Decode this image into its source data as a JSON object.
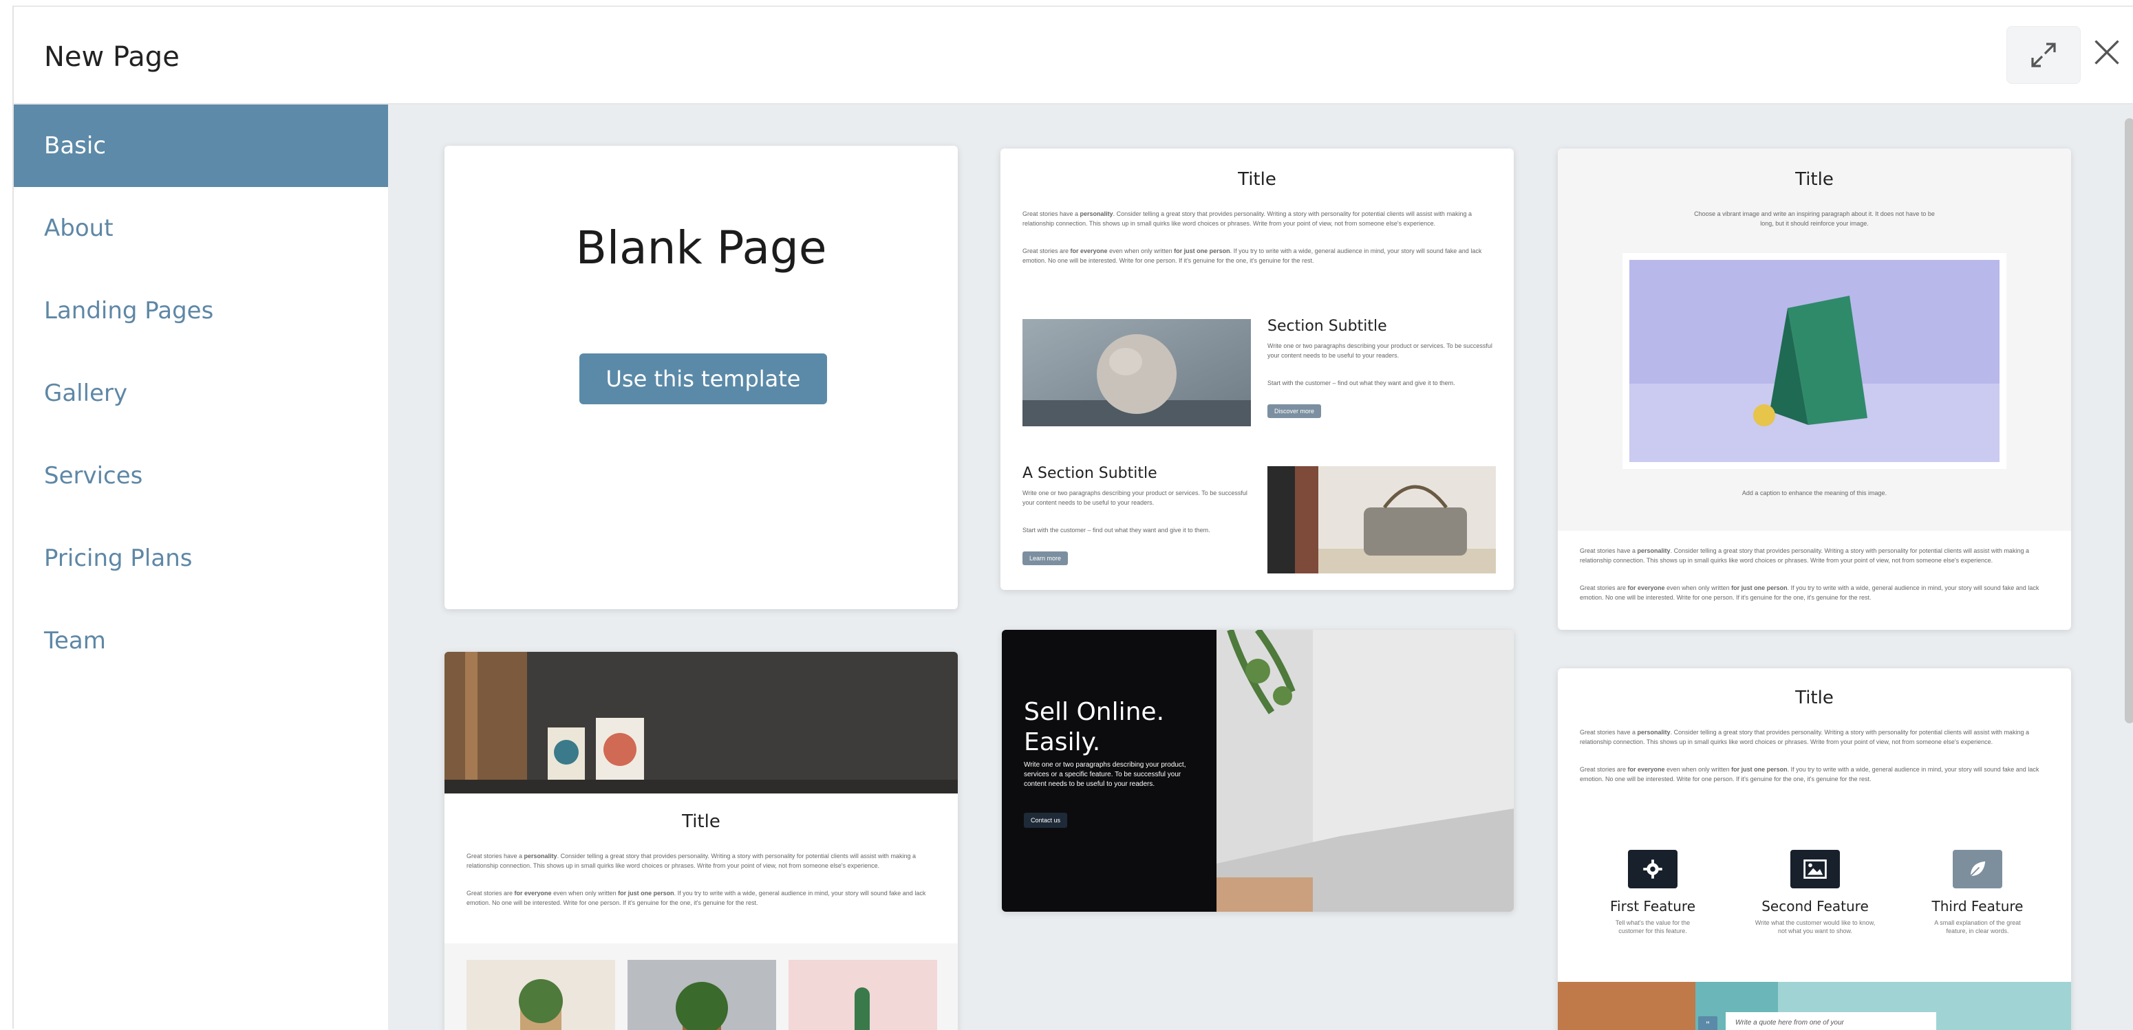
{
  "dialog": {
    "title": "New Page"
  },
  "sidebar": {
    "items": [
      {
        "label": "Basic",
        "active": true
      },
      {
        "label": "About"
      },
      {
        "label": "Landing Pages"
      },
      {
        "label": "Gallery"
      },
      {
        "label": "Services"
      },
      {
        "label": "Pricing Plans"
      },
      {
        "label": "Team"
      }
    ]
  },
  "templates": {
    "blank": {
      "title": "Blank Page",
      "button": "Use this template"
    },
    "t2": {
      "title": "Title",
      "p1_pre": "Great stories have a ",
      "p1_bold": "personality",
      "p1_post": ". Consider telling a great story that provides personality. Writing a story with personality for potential clients will assist with making a relationship connection. This shows up in small quirks like word choices or phrases. Write from your point of view, not from someone else's experience.",
      "p2_pre": "Great stories are ",
      "p2_bold1": "for everyone",
      "p2_mid": " even when only written ",
      "p2_bold2": "for just one person",
      "p2_post": ". If you try to write with a wide, general audience in mind, your story will sound fake and lack emotion. No one will be interested. Write for one person. If it's genuine for the one, it's genuine for the rest.",
      "s1_title": "Section Subtitle",
      "s1_text1": "Write one or two paragraphs describing your product or services. To be successful your content needs to be useful to your readers.",
      "s1_text2": "Start with the customer – find out what they want and give it to them.",
      "s1_btn": "Discover more",
      "s2_title": "A Section Subtitle",
      "s2_text1": "Write one or two paragraphs describing your product or services. To be successful your content needs to be useful to your readers.",
      "s2_text2": "Start with the customer – find out what they want and give it to them.",
      "s2_btn": "Learn more"
    },
    "t3": {
      "title": "Title",
      "intro": "Choose a vibrant image and write an inspiring paragraph about it. It does not have to be long, but it should reinforce your image.",
      "caption": "Add a caption to enhance the meaning of this image.",
      "p1_pre": "Great stories have a ",
      "p1_bold": "personality",
      "p1_post": ". Consider telling a great story that provides personality. Writing a story with personality for potential clients will assist with making a relationship connection. This shows up in small quirks like word choices or phrases. Write from your point of view, not from someone else's experience.",
      "p2_pre": "Great stories are ",
      "p2_bold1": "for everyone",
      "p2_mid": " even when only written ",
      "p2_bold2": "for just one person",
      "p2_post": ". If you try to write with a wide, general audience in mind, your story will sound fake and lack emotion. No one will be interested. Write for one person. If it's genuine for the one, it's genuine for the rest."
    },
    "t4": {
      "title": "Title",
      "p1_pre": "Great stories have a ",
      "p1_bold": "personality",
      "p1_post": ". Consider telling a great story that provides personality. Writing a story with personality for potential clients will assist with making a relationship connection. This shows up in small quirks like word choices or phrases. Write from your point of view, not from someone else's experience.",
      "p2_pre": "Great stories are ",
      "p2_bold1": "for everyone",
      "p2_mid": " even when only written ",
      "p2_bold2": "for just one person",
      "p2_post": ". If you try to write with a wide, general audience in mind, your story will sound fake and lack emotion. No one will be interested. Write for one person. If it's genuine for the one, it's genuine for the rest."
    },
    "t5": {
      "headline1": "Sell Online.",
      "headline2": "Easily.",
      "text": "Write one or two paragraphs describing your product, services or a specific feature. To be successful your content needs to be useful to your readers.",
      "button": "Contact us"
    },
    "t6": {
      "title": "Title",
      "p1_pre": "Great stories have a ",
      "p1_bold": "personality",
      "p1_post": ". Consider telling a great story that provides personality. Writing a story with personality for potential clients will assist with making a relationship connection. This shows up in small quirks like word choices or phrases. Write from your point of view, not from someone else's experience.",
      "p2_pre": "Great stories are ",
      "p2_bold1": "for everyone",
      "p2_mid": " even when only written ",
      "p2_bold2": "for just one person",
      "p2_post": ". If you try to write with a wide, general audience in mind, your story will sound fake and lack emotion. No one will be interested. Write for one person. If it's genuine for the one, it's genuine for the rest.",
      "features": [
        {
          "name": "First Feature",
          "desc1": "Tell what's the value for the",
          "desc2": "customer for this feature."
        },
        {
          "name": "Second Feature",
          "desc1": "Write what the customer would like to know,",
          "desc2": "not what you want to show."
        },
        {
          "name": "Third Feature",
          "desc1": "A small explanation of the great",
          "desc2": "feature, in clear words."
        }
      ],
      "quote": "Write a quote here from one of your"
    }
  },
  "colors": {
    "accent": "#5d8aa8",
    "background": "#eaedf0",
    "sidebar_text": "#5e87a6"
  }
}
